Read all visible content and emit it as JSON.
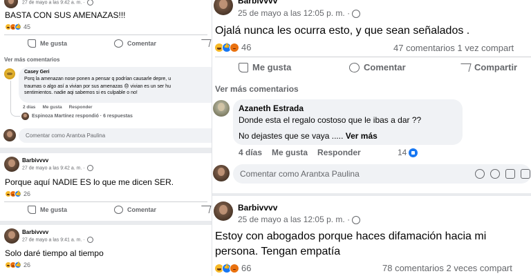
{
  "left": {
    "post1": {
      "meta": "27 de mayo a las 9:42 a. m. ·",
      "text": "BASTA CON SUS AMENAZAS!!!",
      "reaction_count": "45",
      "like_label": "Me gusta",
      "comment_label": "Comentar"
    },
    "more_comments": "Ver más comentarios",
    "comment": {
      "author": "Casey Geri",
      "line1": "Porq la amenazan nose ponen a pensar q podrían causarle depre, u",
      "line2": "traumas o algo así a vivian por sus amenazas 😞 vivian es un ser hu",
      "line3": "sentimientos. nadie aqi sabemos si es culpable o no!",
      "time": "2 días",
      "like": "Me gusta",
      "reply": "Responder",
      "replied": "Espinoza Martínez respondió · 6 respuestas"
    },
    "compose_placeholder": "Comentar como Arantxa Paulina",
    "post2": {
      "author": "Barbivvvv",
      "meta": "27 de mayo a las 9:42 a. m. ·",
      "text": "Porque aquí NADIE ES lo que me dicen SER.",
      "reaction_count": "26",
      "like_label": "Me gusta",
      "comment_label": "Comentar"
    },
    "post3": {
      "author": "Barbivvvv",
      "meta": "27 de mayo a las 9:41 a. m. ·",
      "text": "Solo daré tiempo al tiempo",
      "reaction_count": "26"
    }
  },
  "right": {
    "post1": {
      "author": "Barbivvvv",
      "meta": "25 de mayo a las 12:05 p. m. ·",
      "text": "Ojalá nunca les ocurra esto, y que sean señalados .",
      "reaction_count": "46",
      "stats": "47 comentarios  1 vez compart",
      "like_label": "Me gusta",
      "comment_label": "Comentar",
      "share_label": "Compartir"
    },
    "more_comments": "Ver más comentarios",
    "comment": {
      "author": "Azaneth Estrada",
      "line1": "Donde esta el regalo costoso que le ibas a dar ??",
      "line2": "No dejastes que se vaya .....",
      "see_more": "Ver más",
      "time": "4 días",
      "like": "Me gusta",
      "reply": "Responder",
      "likes": "14"
    },
    "compose_placeholder": "Comentar como Arantxa Paulina",
    "post2": {
      "author": "Barbivvvv",
      "meta": "25 de mayo a las 12:05 p. m. ·",
      "text_line1": "Estoy con abogados porque haces difamación hacia mi",
      "text_line2": "persona. Tengan empatía",
      "reaction_count": "66",
      "stats": "78 comentarios  2 veces compart"
    }
  },
  "colors": {
    "fb_blue": "#1877f2",
    "haha": "#f7b928",
    "angry": "#e9710f",
    "muted": "#65676b"
  }
}
